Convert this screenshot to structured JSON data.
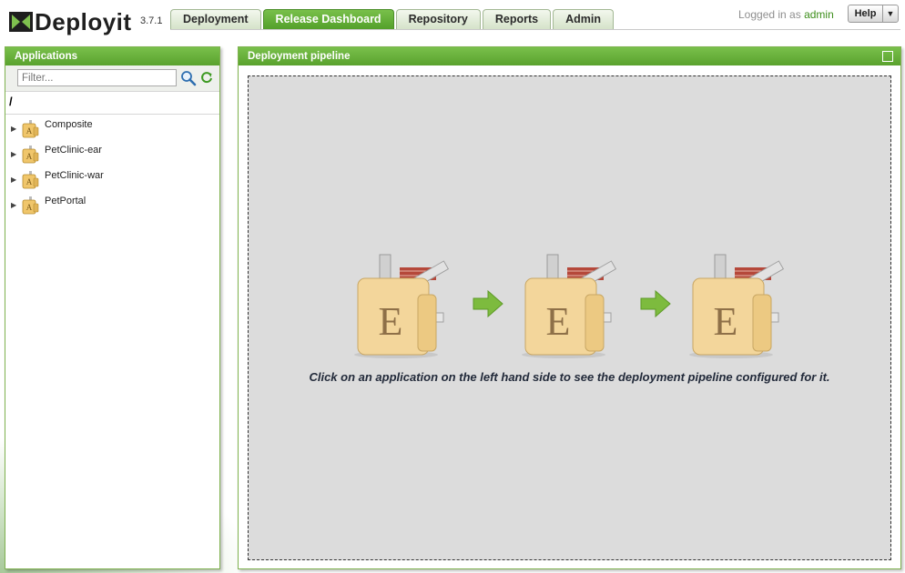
{
  "header": {
    "logo_text": "Deployit",
    "version": "3.7.1",
    "tabs": [
      {
        "label": "Deployment",
        "active": false
      },
      {
        "label": "Release Dashboard",
        "active": true
      },
      {
        "label": "Repository",
        "active": false
      },
      {
        "label": "Reports",
        "active": false
      },
      {
        "label": "Admin",
        "active": false
      }
    ],
    "login_prefix": "Logged in as",
    "username": "admin",
    "help_label": "Help"
  },
  "applications_panel": {
    "title": "Applications",
    "filter_placeholder": "Filter...",
    "path": "/",
    "items": [
      {
        "label": "Composite"
      },
      {
        "label": "PetClinic-ear"
      },
      {
        "label": "PetClinic-war"
      },
      {
        "label": "PetPortal"
      }
    ]
  },
  "pipeline_panel": {
    "title": "Deployment pipeline",
    "message": "Click on an application on the left hand side to see the deployment pipeline configured for it.",
    "package_letter": "E"
  },
  "colors": {
    "accent_green": "#5aa22e",
    "active_tab": "#6ab23c",
    "username": "#3d8e1b"
  },
  "icons": {
    "search": "search-icon",
    "refresh": "refresh-icon",
    "maximize": "maximize-icon",
    "expander": "triangle-right-icon",
    "application": "application-package-icon"
  }
}
